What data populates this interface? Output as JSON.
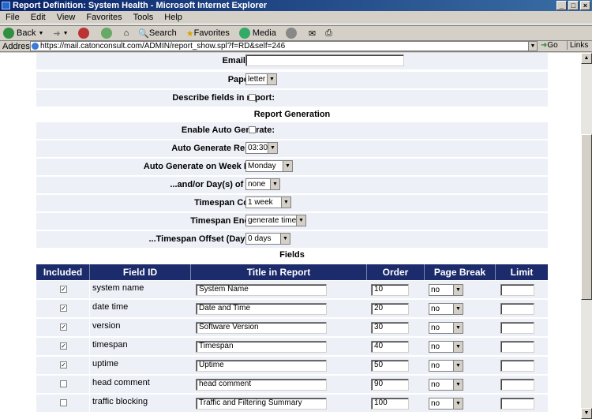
{
  "window": {
    "title": "Report Definition: System Health - Microsoft Internet Explorer"
  },
  "menu": [
    "File",
    "Edit",
    "View",
    "Favorites",
    "Tools",
    "Help"
  ],
  "toolbar": {
    "back": "Back",
    "search": "Search",
    "favorites": "Favorites",
    "media": "Media"
  },
  "address": {
    "label": "Address",
    "url": "https://mail.catonconsult.com/ADMIN/report_show.spl?f=RD&self=246",
    "go": "Go",
    "links": "Links"
  },
  "settings": {
    "email_ps_to": {
      "label": "Email PS To:",
      "value": ""
    },
    "paper_size": {
      "label": "Paper Size:",
      "value": "letter"
    },
    "describe_fields": {
      "label": "Describe fields in report:",
      "checked": false
    }
  },
  "report_generation": {
    "heading": "Report Generation",
    "enable_auto": {
      "label": "Enable Auto Generate:",
      "checked": false
    },
    "auto_at": {
      "label": "Auto Generate Report at:",
      "value": "03:30"
    },
    "week_days": {
      "label": "Auto Generate on Week Days...:",
      "value": "Monday"
    },
    "month_days": {
      "label": "...and/or Day(s) of Month:",
      "value": "none"
    },
    "timespan": {
      "label": "Timespan Covered:",
      "value": "1 week"
    },
    "timespan_ends": {
      "label": "Timespan Ends at...:",
      "value": "generate time"
    },
    "timespan_offset": {
      "label": "...Timespan Offset (Days Ago):",
      "value": "0 days"
    }
  },
  "fields": {
    "heading": "Fields",
    "columns": [
      "Included",
      "Field ID",
      "Title in Report",
      "Order",
      "Page Break",
      "Limit"
    ],
    "rows": [
      {
        "included": true,
        "id": "system name",
        "title": "System Name",
        "order": "10",
        "page_break": "no",
        "limit": ""
      },
      {
        "included": true,
        "id": "date time",
        "title": "Date and Time",
        "order": "20",
        "page_break": "no",
        "limit": ""
      },
      {
        "included": true,
        "id": "version",
        "title": "Software Version",
        "order": "30",
        "page_break": "no",
        "limit": ""
      },
      {
        "included": true,
        "id": "timespan",
        "title": "Timespan",
        "order": "40",
        "page_break": "no",
        "limit": ""
      },
      {
        "included": true,
        "id": "uptime",
        "title": "Uptime",
        "order": "50",
        "page_break": "no",
        "limit": ""
      },
      {
        "included": false,
        "id": "head comment",
        "title": "head comment",
        "order": "90",
        "page_break": "no",
        "limit": ""
      },
      {
        "included": false,
        "id": "traffic blocking",
        "title": "Traffic and Filtering Summary",
        "order": "100",
        "page_break": "no",
        "limit": ""
      }
    ]
  }
}
